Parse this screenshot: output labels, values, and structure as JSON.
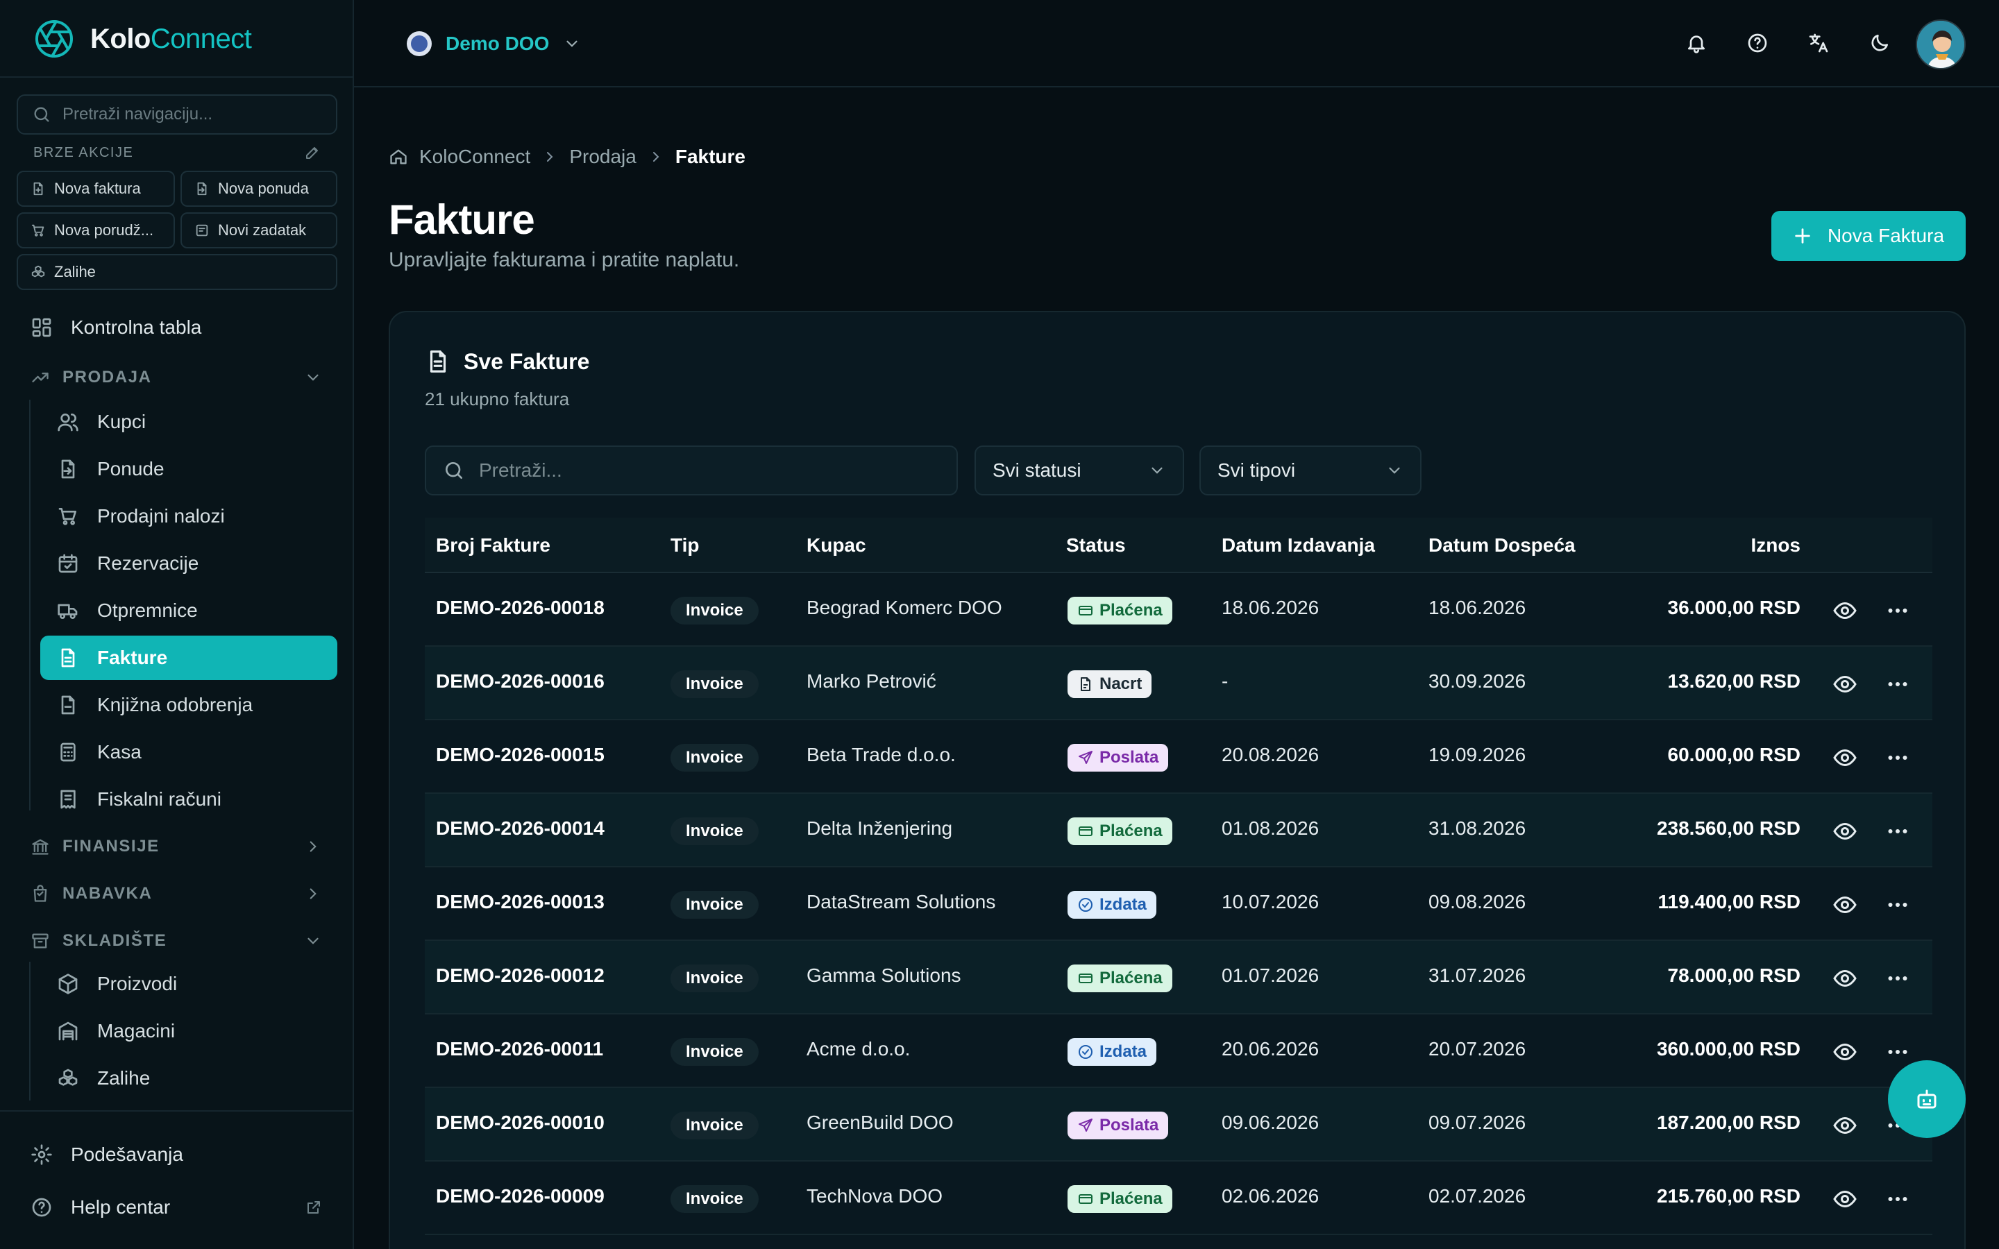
{
  "brand": {
    "name_part1": "Kolo",
    "name_part2": "Connect"
  },
  "sidebar": {
    "search_placeholder": "Pretraži navigaciju...",
    "quick_actions_label": "BRZE AKCIJE",
    "quick_actions": [
      {
        "label": "Nova faktura",
        "icon": "file-plus-icon"
      },
      {
        "label": "Nova ponuda",
        "icon": "file-import-icon"
      },
      {
        "label": "Nova porudž...",
        "icon": "cart-icon"
      },
      {
        "label": "Novi zadatak",
        "icon": "task-icon"
      },
      {
        "label": "Zalihe",
        "icon": "boxes-icon"
      }
    ],
    "dashboard_label": "Kontrolna tabla",
    "sections": {
      "prodaja": "PRODAJA",
      "finansije": "FINANSIJE",
      "nabavka": "NABAVKA",
      "skladiste": "SKLADIŠTE"
    },
    "prodaja_items": [
      "Kupci",
      "Ponude",
      "Prodajni nalozi",
      "Rezervacije",
      "Otpremnice",
      "Fakture",
      "Knjižna odobrenja",
      "Kasa",
      "Fiskalni računi"
    ],
    "skladiste_items": [
      "Proizvodi",
      "Magacini",
      "Zalihe"
    ],
    "settings_label": "Podešavanja",
    "help_label": "Help centar"
  },
  "topbar": {
    "company": "Demo DOO"
  },
  "breadcrumb": {
    "home": "KoloConnect",
    "section": "Prodaja",
    "current": "Fakture"
  },
  "page": {
    "title": "Fakture",
    "subtitle": "Upravljajte fakturama i pratite naplatu.",
    "new_button": "Nova Faktura"
  },
  "card": {
    "title": "Sve Fakture",
    "subtitle": "21 ukupno faktura",
    "search_placeholder": "Pretraži...",
    "status_filter": "Svi statusi",
    "type_filter": "Svi tipovi"
  },
  "table": {
    "headers": {
      "number": "Broj Fakture",
      "type": "Tip",
      "customer": "Kupac",
      "status": "Status",
      "issued": "Datum Izdavanja",
      "due": "Datum Dospeća",
      "amount": "Iznos"
    },
    "rows": [
      {
        "number": "DEMO-2026-00018",
        "type": "Invoice",
        "customer": "Beograd Komerc DOO",
        "status": "Plaćena",
        "issued": "18.06.2026",
        "due": "18.06.2026",
        "amount": "36.000,00 RSD"
      },
      {
        "number": "DEMO-2026-00016",
        "type": "Invoice",
        "customer": "Marko Petrović",
        "status": "Nacrt",
        "issued": "-",
        "due": "30.09.2026",
        "amount": "13.620,00 RSD"
      },
      {
        "number": "DEMO-2026-00015",
        "type": "Invoice",
        "customer": "Beta Trade d.o.o.",
        "status": "Poslata",
        "issued": "20.08.2026",
        "due": "19.09.2026",
        "amount": "60.000,00 RSD"
      },
      {
        "number": "DEMO-2026-00014",
        "type": "Invoice",
        "customer": "Delta Inženjering",
        "status": "Plaćena",
        "issued": "01.08.2026",
        "due": "31.08.2026",
        "amount": "238.560,00 RSD"
      },
      {
        "number": "DEMO-2026-00013",
        "type": "Invoice",
        "customer": "DataStream Solutions",
        "status": "Izdata",
        "issued": "10.07.2026",
        "due": "09.08.2026",
        "amount": "119.400,00 RSD"
      },
      {
        "number": "DEMO-2026-00012",
        "type": "Invoice",
        "customer": "Gamma Solutions",
        "status": "Plaćena",
        "issued": "01.07.2026",
        "due": "31.07.2026",
        "amount": "78.000,00 RSD"
      },
      {
        "number": "DEMO-2026-00011",
        "type": "Invoice",
        "customer": "Acme d.o.o.",
        "status": "Izdata",
        "issued": "20.06.2026",
        "due": "20.07.2026",
        "amount": "360.000,00 RSD"
      },
      {
        "number": "DEMO-2026-00010",
        "type": "Invoice",
        "customer": "GreenBuild DOO",
        "status": "Poslata",
        "issued": "09.06.2026",
        "due": "09.07.2026",
        "amount": "187.200,00 RSD"
      },
      {
        "number": "DEMO-2026-00009",
        "type": "Invoice",
        "customer": "TechNova DOO",
        "status": "Plaćena",
        "issued": "02.06.2026",
        "due": "02.07.2026",
        "amount": "215.760,00 RSD"
      }
    ]
  },
  "colors": {
    "accent": "#10b5b5",
    "background": "#060f14",
    "sidebar": "#081419"
  }
}
